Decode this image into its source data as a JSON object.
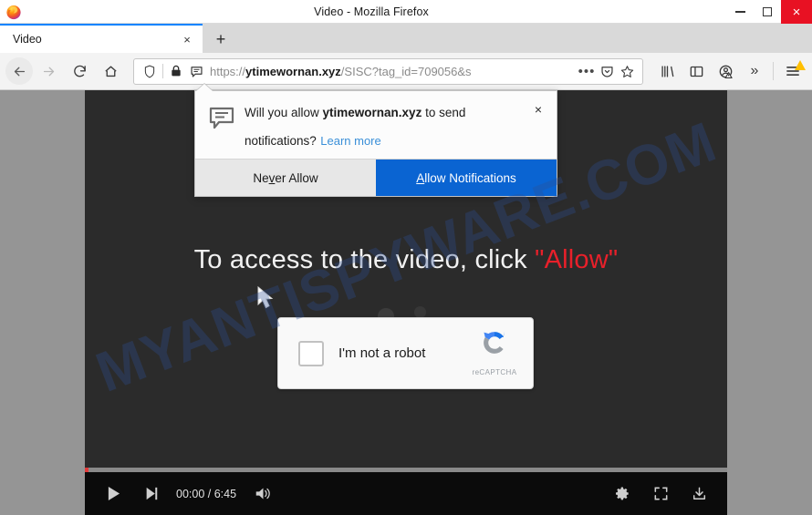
{
  "window": {
    "title": "Video - Mozilla Firefox",
    "app_icon": "firefox-logo-icon",
    "minimize_label": "Minimize",
    "maximize_label": "Maximize",
    "close_label": "×"
  },
  "tabs": {
    "items": [
      {
        "label": "Video",
        "close": "×",
        "active": true
      }
    ],
    "new_tab_label": "+"
  },
  "toolbar": {
    "back_label": "Back",
    "forward_label": "Forward",
    "reload_label": "Reload",
    "home_label": "Home",
    "library_label": "Library",
    "sidebar_label": "Sidebar",
    "account_label": "Account",
    "overflow_label": "»",
    "menu_label": "Open menu"
  },
  "urlbar": {
    "scheme": "https://",
    "domain": "ytimewornan.xyz",
    "path": "/SISC?tag_id=709056&s",
    "full_url": "https://ytimewornan.xyz/SISC?tag_id=709056&s",
    "shield_icon": "tracking-protection-shield-icon",
    "lock_icon": "padlock-icon",
    "permission_icon": "notification-bubble-icon",
    "page_actions_label": "•••",
    "pocket_label": "Save to Pocket",
    "bookmark_label": "Bookmark this page"
  },
  "notification_popup": {
    "icon": "speech-bubble-icon",
    "message_prefix": "Will you allow ",
    "message_domain": "ytimewornan.xyz",
    "message_suffix": " to send notifications?",
    "learn_more": "Learn more",
    "close_label": "×",
    "never_allow": {
      "before": "Ne",
      "accel": "v",
      "after": "er Allow"
    },
    "allow": {
      "accel": "A",
      "after": "llow Notifications"
    },
    "allow_bg": "#0a64d2"
  },
  "page": {
    "headline_before": "To access to the video, click ",
    "headline_allow": "\"Allow\"",
    "headline_allow_color": "#e8202a",
    "background_color": "#959595",
    "video_background": "#2b2b2b",
    "spinner_name": "loading-spinner"
  },
  "captcha": {
    "checkbox_label": "I'm not a robot",
    "brand_text": "reCAPTCHA",
    "logo_icon": "recaptcha-logo-icon",
    "checked": false
  },
  "player": {
    "play_label": "Play",
    "next_label": "Next",
    "timecode": "00:00 / 6:45",
    "current_time": "00:00",
    "duration": "6:45",
    "volume_label": "Mute",
    "settings_label": "Settings",
    "fullscreen_label": "Full screen",
    "download_label": "Download",
    "progress_percent": 0.6
  },
  "watermark": {
    "text": "MYANTISPYWARE.COM",
    "color": "#2d4f93"
  }
}
